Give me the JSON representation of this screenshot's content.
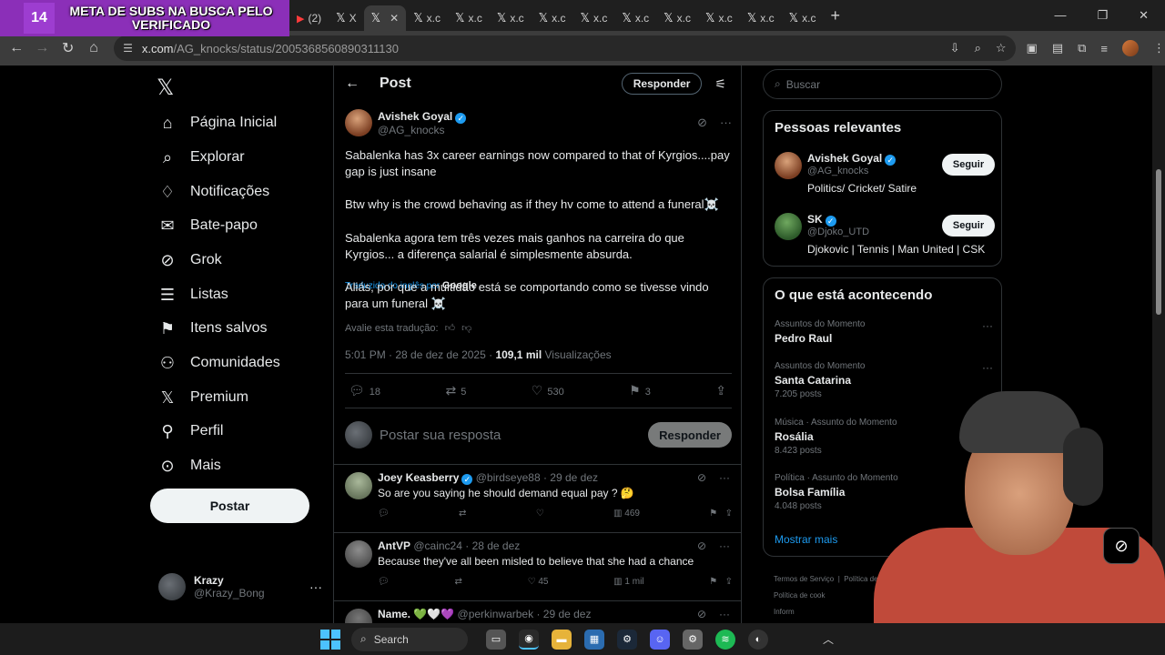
{
  "overlay": {
    "counter": "14",
    "goal": "META DE SUBS NA BUSCA PELO VERIFICADO"
  },
  "tabs": [
    {
      "label": "X"
    },
    {
      "label": "X"
    },
    {
      "label": "x.c"
    },
    {
      "label": "x.c"
    },
    {
      "label": "x.c"
    },
    {
      "label": "x.c"
    },
    {
      "label": "x.c"
    },
    {
      "label": "x.c"
    },
    {
      "label": "x.c"
    },
    {
      "label": "x.c"
    },
    {
      "label": "x.c"
    },
    {
      "label": "x.c"
    }
  ],
  "browser": {
    "youtube_tab": "(2)",
    "url_host": "x.com",
    "url_path": "/AG_knocks/status/2005368560890311130"
  },
  "nav": {
    "items": [
      {
        "label": "Página Inicial",
        "icon": "home-icon"
      },
      {
        "label": "Explorar",
        "icon": "search-icon"
      },
      {
        "label": "Notificações",
        "icon": "bell-icon"
      },
      {
        "label": "Bate-papo",
        "icon": "mail-icon"
      },
      {
        "label": "Grok",
        "icon": "grok-icon"
      },
      {
        "label": "Listas",
        "icon": "list-icon"
      },
      {
        "label": "Itens salvos",
        "icon": "bookmark-icon"
      },
      {
        "label": "Comunidades",
        "icon": "communities-icon"
      },
      {
        "label": "Premium",
        "icon": "x-icon"
      },
      {
        "label": "Perfil",
        "icon": "person-icon"
      },
      {
        "label": "Mais",
        "icon": "more-icon"
      }
    ],
    "post_button": "Postar",
    "account": {
      "name": "Krazy",
      "handle": "@Krazy_Bong"
    }
  },
  "main": {
    "header_title": "Post",
    "reply_pill": "Responder",
    "tweet": {
      "author_name": "Avishek Goyal",
      "author_handle": "@AG_knocks",
      "text_line1": "Sabalenka has 3x career earnings now compared to that of Kyrgios....pay gap is just insane",
      "text_line2": "Btw why is the crowd behaving as if they hv come to attend a funeral☠️",
      "translated_label": "Traduzido do inglês por",
      "translated_by": "Google",
      "translation_line1": "Sabalenka agora tem três vezes mais ganhos na carreira do que Kyrgios... a diferença salarial é simplesmente absurda.",
      "translation_line2": "Aliás, por que a multidão está se comportando como se tivesse vindo para um funeral ☠️",
      "rate_translation": "Avalie esta tradução:",
      "time": "5:01 PM · 28 de dez de 2025 ·",
      "views": "109,1 mil",
      "views_label": "Visualizações",
      "replies": "18",
      "reposts": "5",
      "likes": "530",
      "bookmarks": "3"
    },
    "compose": {
      "placeholder": "Postar sua resposta",
      "button": "Responder"
    },
    "replies": [
      {
        "name": "Joey Keasberry",
        "handle": "@birdseye88",
        "date": "· 29 de dez",
        "text": "So are you saying he should demand equal pay ? 🤔",
        "views": "469",
        "likes": ""
      },
      {
        "name": "AntVP",
        "handle": "@cainc24",
        "date": "· 28 de dez",
        "text": "Because they've all been misled to believe that she had a chance",
        "views": "1 mil",
        "likes": "45"
      },
      {
        "name": "Name. 💚🤍💜",
        "handle": "@perkinwarbek",
        "date": "· 29 de dez",
        "text": "",
        "views": "",
        "likes": ""
      }
    ]
  },
  "right": {
    "search_placeholder": "Buscar",
    "relevant_title": "Pessoas relevantes",
    "people": [
      {
        "name": "Avishek Goyal",
        "handle": "@AG_knocks",
        "bio": "Politics/ Cricket/ Satire",
        "button": "Seguir"
      },
      {
        "name": "SK",
        "handle": "@Djoko_UTD",
        "bio": "Djokovic | Tennis | Man United | CSK",
        "button": "Seguir"
      }
    ],
    "trending_title": "O que está acontecendo",
    "trends": [
      {
        "context": "Assuntos do Momento",
        "name": "Pedro Raul",
        "count": ""
      },
      {
        "context": "Assuntos do Momento",
        "name": "Santa Catarina",
        "count": "7.205 posts"
      },
      {
        "context": "Música · Assunto do Momento",
        "name": "Rosália",
        "count": "8.423 posts"
      },
      {
        "context": "Política · Assunto do Momento",
        "name": "Bolsa Família",
        "count": "4.048 posts"
      }
    ],
    "show_more": "Mostrar mais",
    "footer": [
      "Termos de Serviço",
      "Política de P",
      "Política de cook",
      "Inform"
    ]
  },
  "taskbar": {
    "search": "Search"
  },
  "colors": {
    "accent": "#1d9bf0",
    "overlay": "#8b2fb8",
    "background": "#000000"
  }
}
